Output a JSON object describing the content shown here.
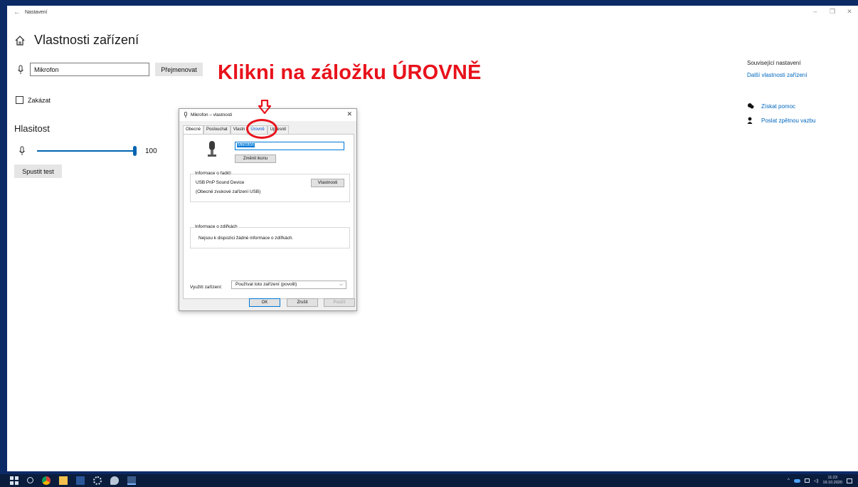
{
  "window": {
    "app_title": "Nastavení",
    "back_glyph": "←",
    "controls": [
      "–",
      "❐",
      "✕"
    ]
  },
  "page": {
    "title": "Vlastnosti zařízení",
    "icon": "home-icon"
  },
  "device": {
    "name_value": "Mikrofon",
    "rename_label": "Přejmenovat",
    "disable_label": "Zakázat"
  },
  "volume": {
    "heading": "Hlasitost",
    "value": "100",
    "level": 1.0,
    "test_label": "Spustit test"
  },
  "annotation": {
    "text": "Klikni na záložku ÚROVNĚ",
    "color": "#e8121b"
  },
  "related": {
    "title": "Související nastavení",
    "link": "Další vlastnosti zařízení",
    "help": "Získat pomoc",
    "feedback": "Poslat zpětnou vazbu"
  },
  "dialog": {
    "title": "Mikrofon – vlastnosti",
    "close_glyph": "✕",
    "tabs": [
      "Obecné",
      "Poslouchat",
      "Vlastn",
      "Úrovně",
      "Upřesnit"
    ],
    "name_value": "Mikrofon",
    "change_icon_label": "Změnit ikonu",
    "controller_legend": "Informace o řadiči",
    "controller_name": "USB PnP Sound Device",
    "controller_desc": "(Obecné zvukové zařízení USB)",
    "properties_label": "Vlastnosti",
    "jack_legend": "Informace o zdířkách",
    "jack_info": "Nejsou k dispozici žádné informace o zdířkách.",
    "usage_label": "Využití zařízení:",
    "usage_value": "Používat toto zařízení (povolit)",
    "ok_label": "OK",
    "cancel_label": "Zrušit",
    "apply_label": "Použít"
  },
  "taskbar": {
    "time": "11:23",
    "date": "19.10.2020",
    "accent": "#0b1d3d"
  }
}
